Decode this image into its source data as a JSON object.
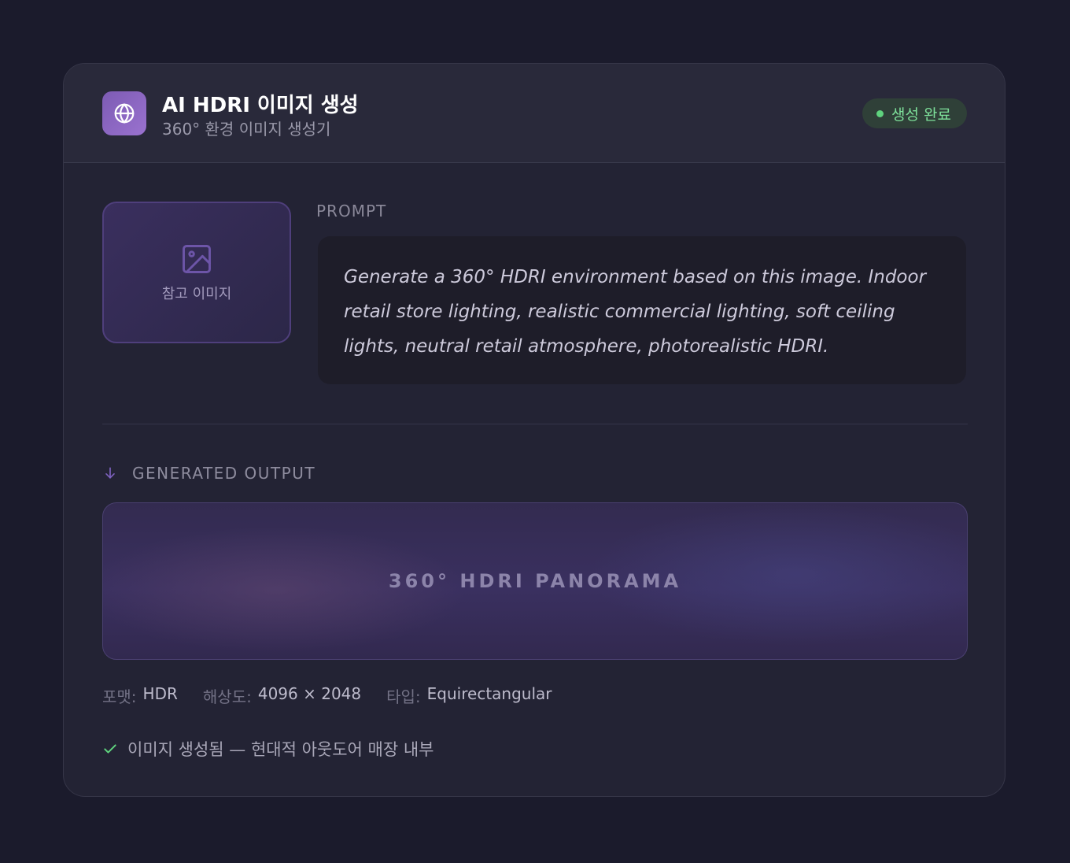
{
  "header": {
    "title": "AI HDRI 이미지 생성",
    "subtitle": "360° 환경 이미지 생성기",
    "app_icon": "globe-icon",
    "status": {
      "label": "생성 완료",
      "color": "#5fd37e"
    }
  },
  "reference": {
    "label": "참고 이미지",
    "icon": "image-icon"
  },
  "prompt": {
    "label": "PROMPT",
    "text": "Generate a 360° HDRI environment based on this image. Indoor retail store lighting, realistic commercial lighting, soft ceiling lights, neutral retail atmosphere, photorealistic HDRI."
  },
  "output": {
    "label": "GENERATED OUTPUT",
    "icon": "arrow-down-icon",
    "panorama_label": "360° HDRI PANORAMA",
    "meta": [
      {
        "key": "포맷:",
        "value": "HDR"
      },
      {
        "key": "해상도:",
        "value": "4096 × 2048"
      },
      {
        "key": "타입:",
        "value": "Equirectangular"
      }
    ],
    "result_icon": "check-icon",
    "result_text": "이미지 생성됨 — 현대적 아웃도어 매장 내부"
  },
  "colors": {
    "accent": "#8a66c4",
    "background": "#1b1b2c",
    "card": "#232334",
    "success": "#5fd37e"
  }
}
